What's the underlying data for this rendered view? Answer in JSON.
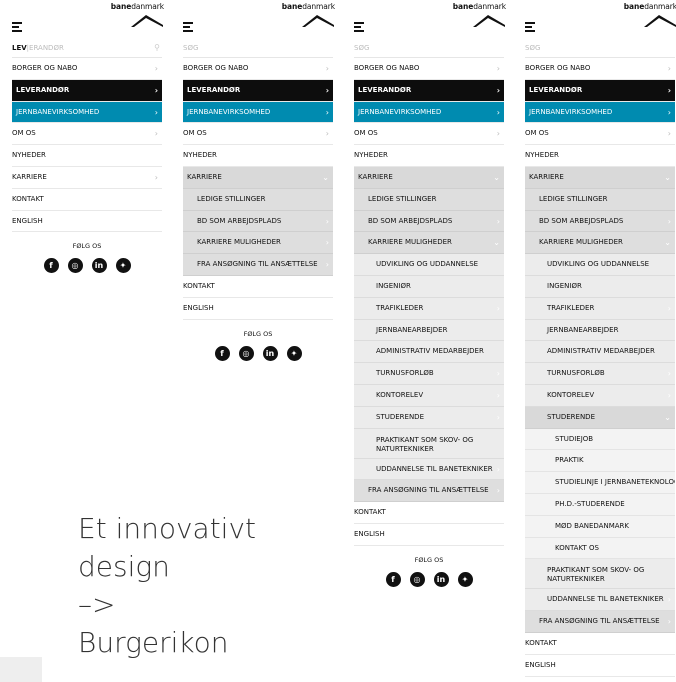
{
  "logo": {
    "bold": "bane",
    "rest": "danmark"
  },
  "social_label": "FØLG OS",
  "social_icons": [
    "facebook-icon",
    "instagram-icon",
    "linkedin-icon",
    "twitter-icon"
  ],
  "colors": {
    "accent_blue": "#008bb0",
    "dark": "#0d0d0d",
    "grey": "#d9d9d9"
  },
  "panel1": {
    "search_typed": "LEV",
    "search_rest": "ERANDØR",
    "items": [
      "BORGER OG NABO",
      "LEVERANDØR",
      "JERNBANEVIRKSOMHED",
      "OM OS",
      "NYHEDER",
      "KARRIERE",
      "KONTAKT",
      "ENGLISH"
    ]
  },
  "panel2": {
    "search_placeholder": "SØG",
    "items": [
      "BORGER OG NABO",
      "LEVERANDØR",
      "JERNBANEVIRKSOMHED",
      "OM OS",
      "NYHEDER",
      "KARRIERE"
    ],
    "karriere_sub": [
      "LEDIGE STILLINGER",
      "BD SOM ARBEJDSPLADS",
      "KARRIERE MULIGHEDER",
      "FRA ANSØGNING TIL ANSÆTTELSE"
    ],
    "tail": [
      "KONTAKT",
      "ENGLISH"
    ]
  },
  "panel3": {
    "search_placeholder": "SØG",
    "items": [
      "BORGER OG NABO",
      "LEVERANDØR",
      "JERNBANEVIRKSOMHED",
      "OM OS",
      "NYHEDER",
      "KARRIERE"
    ],
    "karriere_sub": [
      "LEDIGE STILLINGER",
      "BD SOM ARBEJDSPLADS",
      "KARRIERE MULIGHEDER"
    ],
    "muligheder_sub": [
      "UDVIKLING OG UDDANNELSE",
      "INGENIØR",
      "TRAFIKLEDER",
      "JERNBANEARBEJDER",
      "ADMINISTRATIV MEDARBEJDER",
      "TURNUSFORLØB",
      "KONTORELEV",
      "STUDERENDE",
      "PRAKTIKANT SOM SKOV- OG NATURTEKNIKER",
      "UDDANNELSE TIL BANETEKNIKER"
    ],
    "last_sub": "FRA ANSØGNING TIL ANSÆTTELSE",
    "tail": [
      "KONTAKT",
      "ENGLISH"
    ]
  },
  "panel4": {
    "search_placeholder": "SØG",
    "items": [
      "BORGER OG NABO",
      "LEVERANDØR",
      "JERNBANEVIRKSOMHED",
      "OM OS",
      "NYHEDER",
      "KARRIERE"
    ],
    "karriere_sub": [
      "LEDIGE STILLINGER",
      "BD SOM ARBEJDSPLADS",
      "KARRIERE MULIGHEDER"
    ],
    "muligheder_sub": [
      "UDVIKLING OG UDDANNELSE",
      "INGENIØR",
      "TRAFIKLEDER",
      "JERNBANEARBEJDER",
      "ADMINISTRATIV MEDARBEJDER",
      "TURNUSFORLØB",
      "KONTORELEV",
      "STUDERENDE"
    ],
    "studerende_sub": [
      "STUDIEJOB",
      "PRAKTIK",
      "STUDIELINJE I JERNBANETEKNOLOGI",
      "PH.D.-STUDERENDE",
      "MØD BANEDANMARK",
      "KONTAKT OS"
    ],
    "after_studerende": [
      "PRAKTIKANT SOM SKOV- OG NATURTEKNIKER",
      "UDDANNELSE TIL BANETEKNIKER"
    ],
    "last_sub": "FRA ANSØGNING TIL ANSÆTTELSE",
    "tail": [
      "KONTAKT",
      "ENGLISH"
    ]
  },
  "caption": {
    "line1": "Et innovativt",
    "line2": "design",
    "line3": "–>",
    "line4": "Burgerikon"
  }
}
